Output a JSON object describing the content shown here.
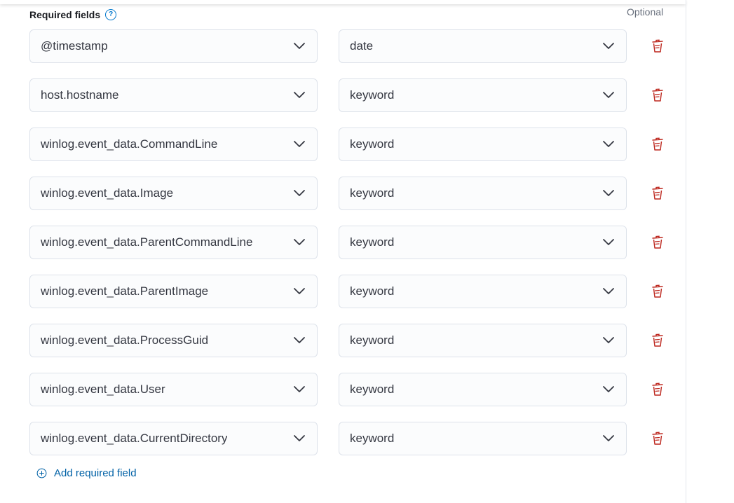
{
  "header": {
    "title": "Required fields",
    "help_icon": "question-circle-icon",
    "optional_label": "Optional"
  },
  "fields": [
    {
      "name": "@timestamp",
      "type": "date"
    },
    {
      "name": "host.hostname",
      "type": "keyword"
    },
    {
      "name": "winlog.event_data.CommandLine",
      "type": "keyword"
    },
    {
      "name": "winlog.event_data.Image",
      "type": "keyword"
    },
    {
      "name": "winlog.event_data.ParentCommandLine",
      "type": "keyword"
    },
    {
      "name": "winlog.event_data.ParentImage",
      "type": "keyword"
    },
    {
      "name": "winlog.event_data.ProcessGuid",
      "type": "keyword"
    },
    {
      "name": "winlog.event_data.User",
      "type": "keyword"
    },
    {
      "name": "winlog.event_data.CurrentDirectory",
      "type": "keyword"
    }
  ],
  "icons": {
    "dropdown": "chevron-down-icon",
    "delete": "trash-icon",
    "add": "plus-circle-icon"
  },
  "colors": {
    "link": "#0061a6",
    "delete": "#bd271e",
    "help": "#0077cc"
  },
  "add_button": {
    "label": "Add required field"
  }
}
